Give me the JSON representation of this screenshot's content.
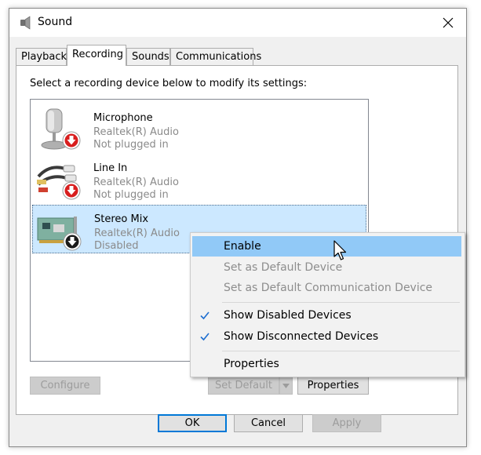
{
  "window": {
    "title": "Sound",
    "close_icon": "close-icon",
    "app_icon": "speaker-icon"
  },
  "tabs": [
    {
      "label": "Playback",
      "active": false
    },
    {
      "label": "Recording",
      "active": true
    },
    {
      "label": "Sounds",
      "active": false
    },
    {
      "label": "Communications",
      "active": false
    }
  ],
  "instruction": "Select a recording device below to modify its settings:",
  "devices": [
    {
      "name": "Microphone",
      "driver": "Realtek(R) Audio",
      "status": "Not plugged in",
      "icon": "microphone-icon",
      "badge": "red-down-arrow-badge"
    },
    {
      "name": "Line In",
      "driver": "Realtek(R) Audio",
      "status": "Not plugged in",
      "icon": "line-in-cable-icon",
      "badge": "red-down-arrow-badge"
    },
    {
      "name": "Stereo Mix",
      "driver": "Realtek(R) Audio",
      "status": "Disabled",
      "icon": "sound-card-icon",
      "badge": "black-down-arrow-badge",
      "selected": true
    }
  ],
  "context_menu": {
    "items": [
      {
        "label": "Enable",
        "state": "hover"
      },
      {
        "label": "Set as Default Device",
        "state": "disabled"
      },
      {
        "label": "Set as Default Communication Device",
        "state": "disabled"
      },
      {
        "label": "Show Disabled Devices",
        "checked": true
      },
      {
        "label": "Show Disconnected Devices",
        "checked": true
      },
      {
        "label": "Properties"
      }
    ]
  },
  "panel_buttons": {
    "configure": "Configure",
    "set_default": "Set Default",
    "properties": "Properties"
  },
  "dialog_buttons": {
    "ok": "OK",
    "cancel": "Cancel",
    "apply": "Apply"
  },
  "colors": {
    "selection": "#cce8ff",
    "menu_hover": "#91c9f7",
    "accent": "#0078d7",
    "badge_red": "#d81e1e",
    "check": "#1e6fd0"
  }
}
